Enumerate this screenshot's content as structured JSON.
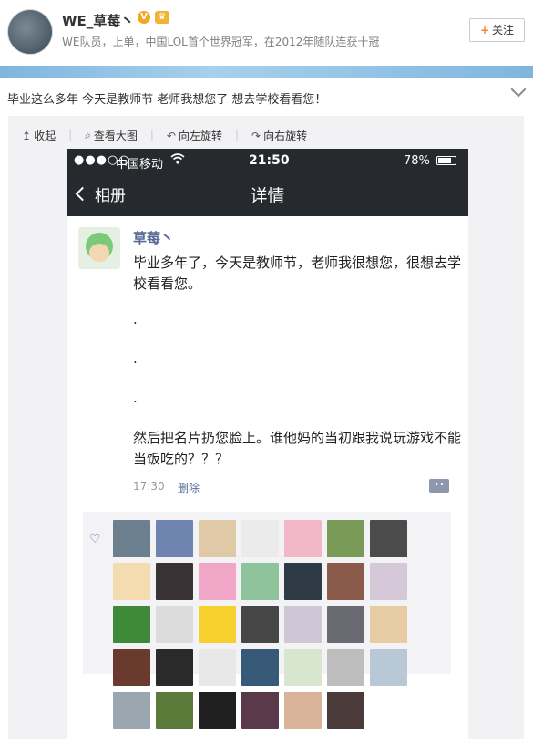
{
  "profile": {
    "name": "WE_草莓丶",
    "verified_badge": "V",
    "bio": "WE队员，上单，中国LOL首个世界冠军，在2012年随队连获十冠",
    "follow_label": "关注",
    "follow_icon": "+"
  },
  "post": {
    "text": "毕业这么多年 今天是教师节 老师我想您了 想去学校看看您！"
  },
  "toolbar": {
    "collapse": "收起",
    "view_large": "查看大图",
    "rotate_left": "向左旋转",
    "rotate_right": "向右旋转"
  },
  "phone": {
    "status": {
      "signal": "●●●○○",
      "carrier": "中国移动",
      "time": "21:50",
      "battery": "78%",
      "battery_level": 0.78
    },
    "nav": {
      "back_label": "相册",
      "title": "详情"
    },
    "moment": {
      "author": "草莓丶",
      "text1": "毕业多年了，今天是教师节，老师我很想您，很想去学校看看您。",
      "dot": ".",
      "text2": "然后把名片扔您脸上。谁他妈的当初跟我说玩游戏不能当饭吃的？？？",
      "time": "17:30",
      "delete_label": "删除"
    },
    "likes": {
      "avatar_colors": [
        "#6b7f8e",
        "#6f85b0",
        "#e0c9a6",
        "#ebebeb",
        "#f3b8c8",
        "#7a9a57",
        "#4b4b4b",
        "#f4dcb0",
        "#3a3336",
        "#f0a6c6",
        "#8fc39b",
        "#2e3a46",
        "#8a5a4a",
        "#d5c8d9",
        "#3e8a3a",
        "#dcdcdc",
        "#f6d12e",
        "#474747",
        "#cfc6d6",
        "#6a6a72",
        "#e7cba2",
        "#6b3a2e",
        "#2a2a2a",
        "#e8e8e8",
        "#365a78",
        "#d8e6d0",
        "#bdbdbd",
        "#b8c8d6",
        "#9aa7b0",
        "#5a7a3a",
        "#202020",
        "#5a3a4a",
        "#d9b49a",
        "#4a3a3a"
      ]
    }
  }
}
